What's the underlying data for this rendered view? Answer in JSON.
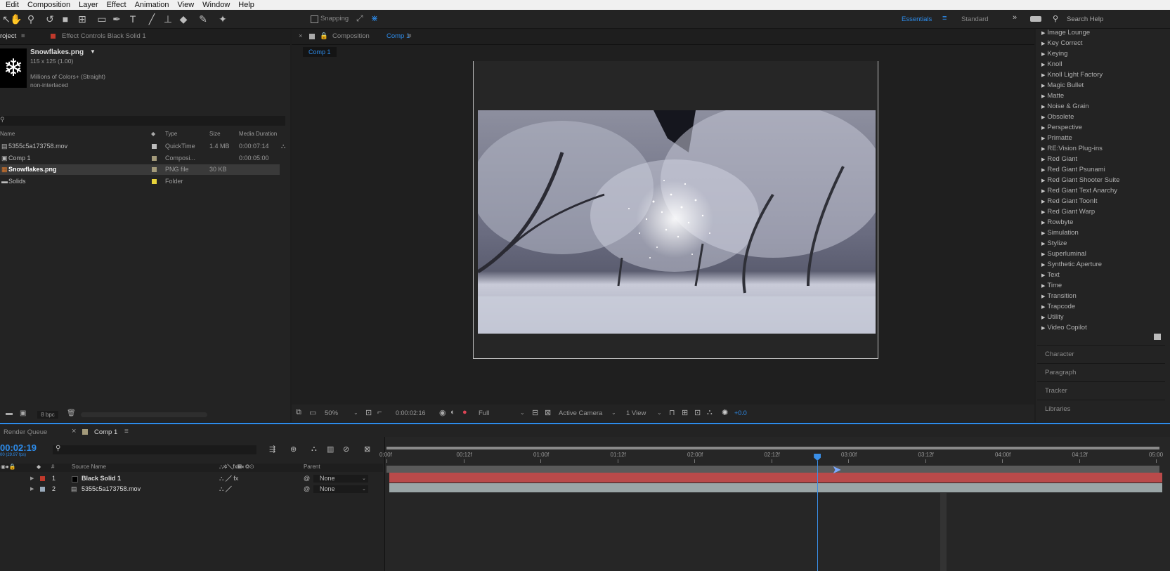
{
  "menu": [
    "Edit",
    "Composition",
    "Layer",
    "Effect",
    "Animation",
    "View",
    "Window",
    "Help"
  ],
  "toolbar": {
    "snapping_label": "Snapping",
    "workspaces": [
      "Essentials",
      "Standard"
    ],
    "search_placeholder": "Search Help",
    "active_color": "#2d8ceb"
  },
  "project": {
    "tab_project": "roject",
    "tab_effect_controls": "Effect Controls Black Solid 1",
    "preview": {
      "name": "Snowflakes.png",
      "dims": "115 x 125 (1.00)",
      "colors": "Millions of Colors+ (Straight)",
      "interlace": "non-interlaced"
    },
    "columns": [
      "Name",
      "Type",
      "Size",
      "Media Duration"
    ],
    "items": [
      {
        "name": "5355c5a173758.mov",
        "type": "QuickTime",
        "size": "1.4 MB",
        "duration": "0:00:07:14",
        "swatch": "#bcbcbc"
      },
      {
        "name": "Comp 1",
        "type": "Composi...",
        "size": "",
        "duration": "0:00:05:00",
        "swatch": "#a39a7a"
      },
      {
        "name": "Snowflakes.png",
        "type": "PNG file",
        "size": "30 KB",
        "duration": "",
        "swatch": "#a39a7a"
      },
      {
        "name": "Solids",
        "type": "Folder",
        "size": "",
        "duration": "",
        "swatch": "#e8d33a"
      }
    ],
    "bpc": "8 bpc"
  },
  "composition": {
    "tab_label": "Composition",
    "comp_name": "Comp 1",
    "subtab": "Comp 1",
    "zoom": "50%",
    "timecode": "0:00:02:16",
    "quality": "Full",
    "camera": "Active Camera",
    "views": "1 View",
    "exposure": "+0.0"
  },
  "effects": {
    "items": [
      "Image Lounge",
      "Key Correct",
      "Keying",
      "Knoll",
      "Knoll Light Factory",
      "Magic Bullet",
      "Matte",
      "Noise & Grain",
      "Obsolete",
      "Perspective",
      "Primatte",
      "RE:Vision Plug-ins",
      "Red Giant",
      "Red Giant Psunami",
      "Red Giant Shooter Suite",
      "Red Giant Text Anarchy",
      "Red Giant ToonIt",
      "Red Giant Warp",
      "Rowbyte",
      "Simulation",
      "Stylize",
      "Superluminal",
      "Synthetic Aperture",
      "Text",
      "Time",
      "Transition",
      "Trapcode",
      "Utility",
      "Video Copilot"
    ],
    "panels": [
      "Character",
      "Paragraph",
      "Tracker",
      "Libraries"
    ]
  },
  "timeline": {
    "tab_render_queue": "Render Queue",
    "tab_comp": "Comp 1",
    "timecode": "00:02:19",
    "fps": "00 (29.97 fps)",
    "columns": {
      "source_name": "Source Name",
      "parent": "Parent"
    },
    "layers": [
      {
        "num": "1",
        "name": "Black Solid 1",
        "parent": "None",
        "color": "#c0392b"
      },
      {
        "num": "2",
        "name": "5355c5a173758.mov",
        "parent": "None",
        "color": "#9ab"
      }
    ],
    "ruler": [
      "0:00f",
      "00:12f",
      "01:00f",
      "01:12f",
      "02:00f",
      "02:12f",
      "03:00f",
      "03:12f",
      "04:00f",
      "04:12f",
      "05:00"
    ],
    "playhead_time": 2.8,
    "duration": 5.0
  }
}
